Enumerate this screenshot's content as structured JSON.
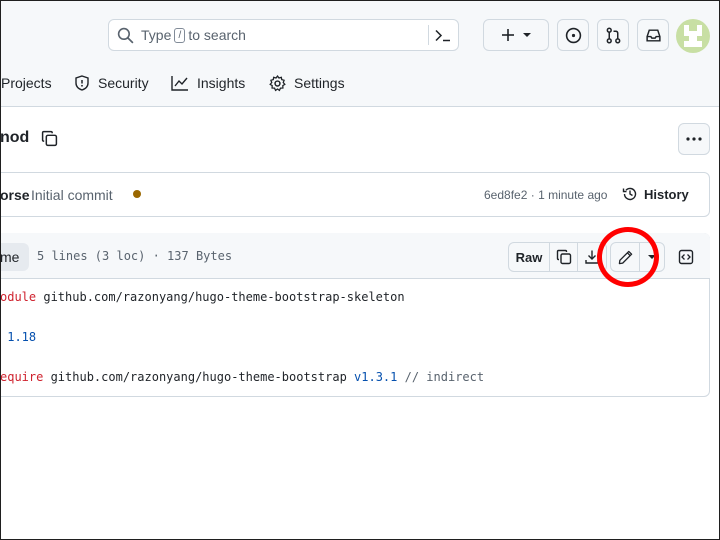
{
  "header": {
    "search": {
      "prefix": "Type",
      "slash_key": "/",
      "suffix": "to search"
    },
    "avatar_color": "#c8dfa4"
  },
  "tabs": [
    {
      "label": "Projects",
      "icon": "table-icon"
    },
    {
      "label": "Security",
      "icon": "shield-icon"
    },
    {
      "label": "Insights",
      "icon": "graph-icon"
    },
    {
      "label": "Settings",
      "icon": "gear-icon"
    }
  ],
  "file": {
    "name_partial": "nod",
    "commit": {
      "author_partial": "orse",
      "message": "Initial commit",
      "hash": "6ed8fe2",
      "separator": "·",
      "time": "1 minute ago",
      "history_label": "History",
      "status_color": "#9a6700"
    },
    "view_tab_partial": "me",
    "info": "5 lines (3 loc) · 137 Bytes",
    "raw_label": "Raw",
    "code": [
      {
        "keyword": "odule",
        "rest": " github.com/razonyang/hugo-theme-bootstrap-skeleton",
        "version": "",
        "comment": ""
      },
      {
        "keyword": "",
        "rest": "",
        "version": "",
        "comment": ""
      },
      {
        "keyword": "",
        "rest": " 1.18",
        "version": "",
        "comment": ""
      },
      {
        "keyword": "",
        "rest": "",
        "version": "",
        "comment": ""
      },
      {
        "keyword": "equire",
        "rest": " github.com/razonyang/hugo-theme-bootstrap ",
        "version": "v1.3.1",
        "comment": " // indirect"
      }
    ]
  },
  "annotation_color": "#ff0000"
}
